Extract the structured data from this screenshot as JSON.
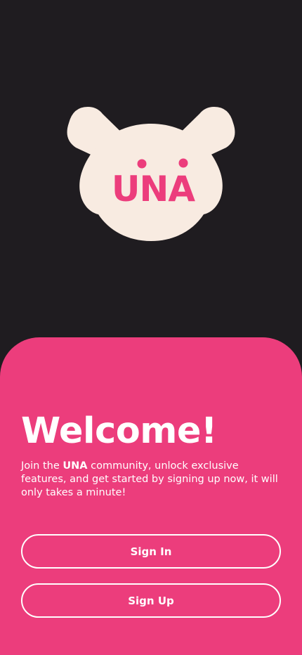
{
  "colors": {
    "background": "#1f1c20",
    "sheet": "#ec3d7c",
    "logo_cream": "#f8ebe1",
    "logo_pink": "#ec3d7c",
    "text": "#ffffff"
  },
  "logo": {
    "text": "UNA",
    "icon": "bear-logo-icon"
  },
  "welcome": {
    "title": "Welcome!",
    "text_prefix": "Join the ",
    "brand": "UNA",
    "text_suffix": " community, unlock exclusive features, and get started by signing up now, it will only takes a minute!"
  },
  "buttons": {
    "sign_in": "Sign In",
    "sign_up": "Sign Up"
  }
}
